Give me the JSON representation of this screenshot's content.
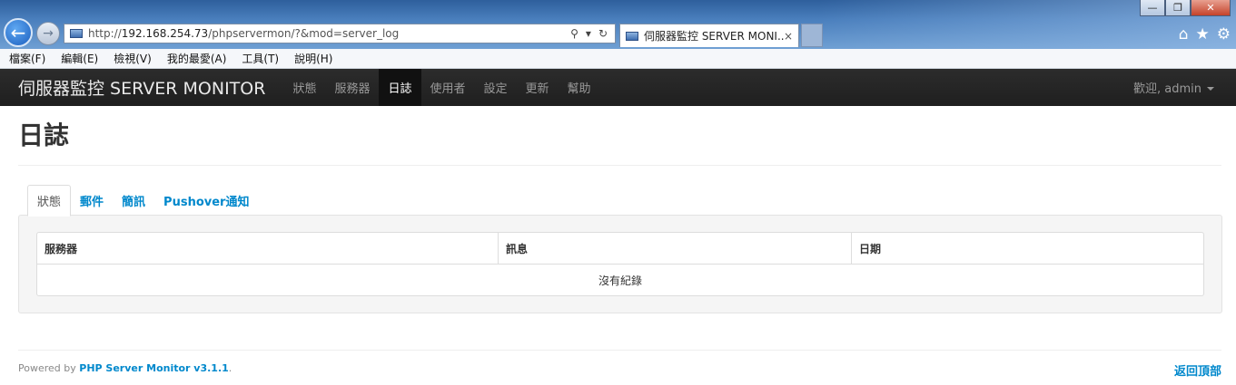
{
  "browser": {
    "url_prefix": "http://",
    "url_host": "192.168.254.73",
    "url_path": "/phpservermon/?&mod=server_log",
    "tab_title": "伺服器監控 SERVER MONI...",
    "tab_close": "×",
    "window_buttons": {
      "minimize": "—",
      "restore": "❐",
      "close": "✕"
    },
    "icons": [
      "search-icon",
      "dropdown-icon",
      "refresh-icon",
      "home-icon",
      "star-icon",
      "gear-icon"
    ]
  },
  "menu": [
    "檔案(F)",
    "編輯(E)",
    "檢視(V)",
    "我的最愛(A)",
    "工具(T)",
    "說明(H)"
  ],
  "navbar": {
    "brand": "伺服器監控 SERVER MONITOR",
    "items": [
      "狀態",
      "服務器",
      "日誌",
      "使用者",
      "設定",
      "更新",
      "幫助"
    ],
    "active_index": 2,
    "user": "歡迎, admin"
  },
  "page": {
    "title": "日誌",
    "tabs": [
      "狀態",
      "郵件",
      "簡訊",
      "Pushover通知"
    ],
    "active_tab": 0,
    "table": {
      "headers": [
        "服務器",
        "訊息",
        "日期"
      ],
      "empty_message": "沒有紀錄"
    }
  },
  "footer": {
    "powered_by": "Powered by",
    "product": "PHP Server Monitor v3.1.1",
    "period": ".",
    "back_to_top": "返回頂部"
  },
  "colors": {
    "navbar_bg": "#222222",
    "link": "#0088cc",
    "well_bg": "#f5f5f5"
  }
}
